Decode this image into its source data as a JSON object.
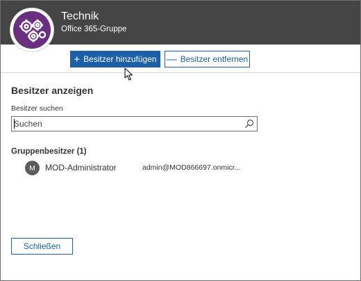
{
  "header": {
    "title": "Technik",
    "subtitle": "Office 365-Gruppe",
    "logo_icon": "gears-icon",
    "logo_color": "#6b2f82",
    "background_color": "#454545"
  },
  "toolbar": {
    "add_icon": "+",
    "add_label": "Besitzer hinzufügen",
    "remove_icon": "—",
    "remove_label": "Besitzer entfernen",
    "accent_color": "#1a5fa8"
  },
  "main": {
    "section_title": "Besitzer anzeigen",
    "search": {
      "label": "Besitzer suchen",
      "placeholder": "Suchen",
      "value": "",
      "icon": "search-icon"
    },
    "owners_heading": "Gruppenbesitzer (1)",
    "owners": [
      {
        "initial": "M",
        "name": "MOD-Administrator",
        "email": "admin@MOD866697.onmicr..."
      }
    ]
  },
  "footer": {
    "close_label": "Schließen"
  }
}
